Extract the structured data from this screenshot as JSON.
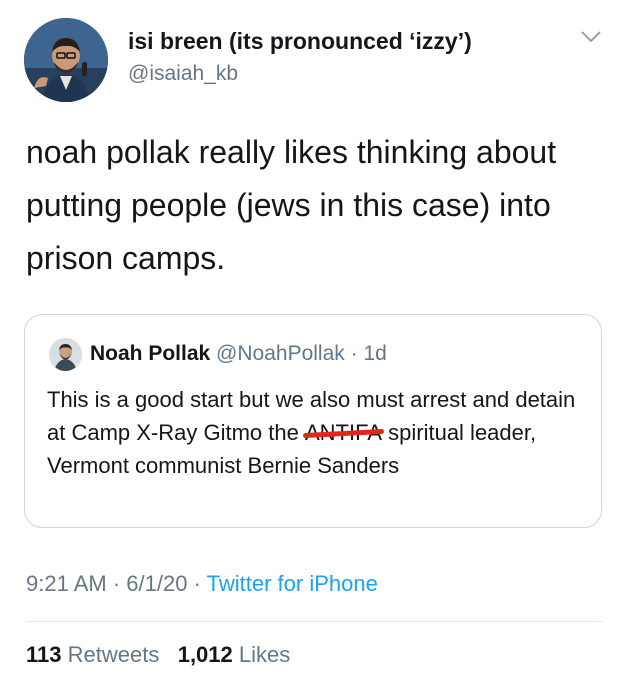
{
  "author": {
    "name": "isi breen (its pronounced ‘izzy’)",
    "handle": "@isaiah_kb"
  },
  "tweet": {
    "text_line1": "noah pollak really likes thinking about",
    "text_line2": "putting people (jews in this case) into",
    "text_line3": "prison camps."
  },
  "quoted_tweet": {
    "name": "Noah Pollak",
    "handle": "@NoahPollak",
    "separator": "·",
    "age": "1d",
    "text_before": "This is a good start but we also must arrest and detain at Camp X-Ray Gitmo the",
    "struck_word": "ANTIFA",
    "text_after": "spiritual leader, Vermont communist Bernie Sanders"
  },
  "meta": {
    "time": "9:21 AM",
    "separator": "·",
    "date": "6/1/20",
    "source": "Twitter for iPhone"
  },
  "stats": {
    "retweets_count": "113",
    "retweets_label": "Retweets",
    "likes_count": "1,012",
    "likes_label": "Likes"
  },
  "colors": {
    "text": "#14171a",
    "secondary": "#657786",
    "link": "#1da1f2",
    "border": "#ccd6dd",
    "strike": "#e0271c"
  }
}
